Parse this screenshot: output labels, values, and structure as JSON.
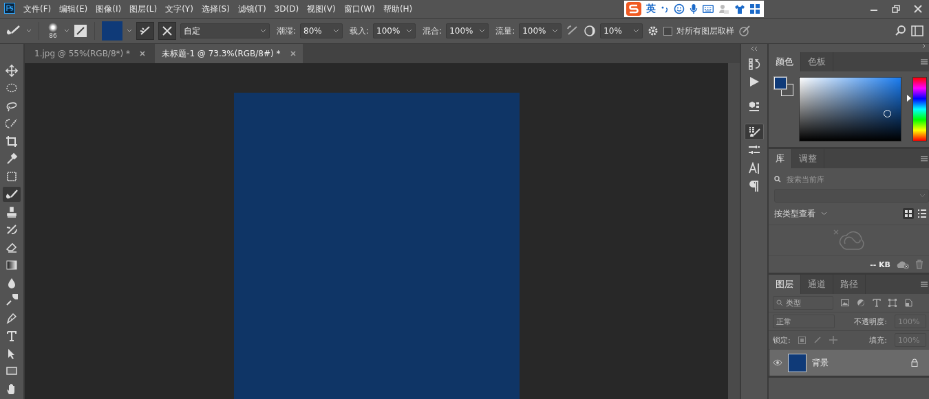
{
  "menu": [
    "文件(F)",
    "编辑(E)",
    "图像(I)",
    "图层(L)",
    "文字(Y)",
    "选择(S)",
    "滤镜(T)",
    "3D(D)",
    "视图(V)",
    "窗口(W)",
    "帮助(H)"
  ],
  "ime_bar": {
    "mode": "英"
  },
  "options_bar": {
    "brush_size": "86",
    "mode": "自定",
    "fields": [
      {
        "label": "潮湿:",
        "value": "80%"
      },
      {
        "label": "载入:",
        "value": "100%"
      },
      {
        "label": "混合:",
        "value": "100%"
      },
      {
        "label": "流量:",
        "value": "100%"
      }
    ],
    "smoothing": "10%",
    "sample_all": {
      "label": "对所有图层取样",
      "checked": false
    }
  },
  "tabs": [
    {
      "label": "1.jpg @ 55%(RGB/8*) *",
      "selected": false
    },
    {
      "label": "未标题-1 @ 73.3%(RGB/8#) *",
      "selected": true
    }
  ],
  "tools": [
    {
      "kind": "move",
      "selected": false
    },
    {
      "kind": "marquee",
      "selected": false
    },
    {
      "kind": "lasso",
      "selected": false
    },
    {
      "kind": "quick-select",
      "selected": false
    },
    {
      "kind": "crop",
      "selected": false
    },
    {
      "kind": "eyedropper",
      "selected": false
    },
    {
      "kind": "patch",
      "selected": false
    },
    {
      "kind": "brush",
      "selected": true
    },
    {
      "kind": "stamp",
      "selected": false
    },
    {
      "kind": "history-brush",
      "selected": false
    },
    {
      "kind": "eraser",
      "selected": false
    },
    {
      "kind": "gradient",
      "selected": false
    },
    {
      "kind": "blur",
      "selected": false
    },
    {
      "kind": "dodge",
      "selected": false
    },
    {
      "kind": "pen",
      "selected": false
    },
    {
      "kind": "type",
      "selected": false
    },
    {
      "kind": "path-select",
      "selected": false
    },
    {
      "kind": "rectangle",
      "selected": false
    },
    {
      "kind": "hand",
      "selected": false
    }
  ],
  "dock_icons": [
    {
      "kind": "history",
      "selected": false
    },
    {
      "kind": "actions",
      "selected": false
    },
    {
      "kind": "model",
      "selected": false
    },
    {
      "kind": "brush-settings",
      "selected": true
    },
    {
      "kind": "adjust",
      "selected": false
    },
    {
      "kind": "character",
      "selected": false
    },
    {
      "kind": "paragraph",
      "selected": false
    }
  ],
  "color_panel": {
    "tabs": [
      {
        "label": "颜色",
        "selected": true
      },
      {
        "label": "色板",
        "selected": false
      }
    ]
  },
  "library_panel": {
    "tabs": [
      {
        "label": "库",
        "selected": true
      },
      {
        "label": "调整",
        "selected": false
      }
    ],
    "search_placeholder": "搜索当前库",
    "view_label": "按类型查看",
    "size": "-- KB"
  },
  "layers_panel": {
    "tabs": [
      {
        "label": "图层",
        "selected": true
      },
      {
        "label": "通道",
        "selected": false
      },
      {
        "label": "路径",
        "selected": false
      }
    ],
    "filter": "类型",
    "blend_mode": "正常",
    "opacity_label": "不透明度:",
    "opacity": "100%",
    "lock_label": "锁定:",
    "fill_label": "填充:",
    "fill": "100%",
    "layers": [
      {
        "name": "背景",
        "selected": true,
        "locked": true
      }
    ]
  }
}
